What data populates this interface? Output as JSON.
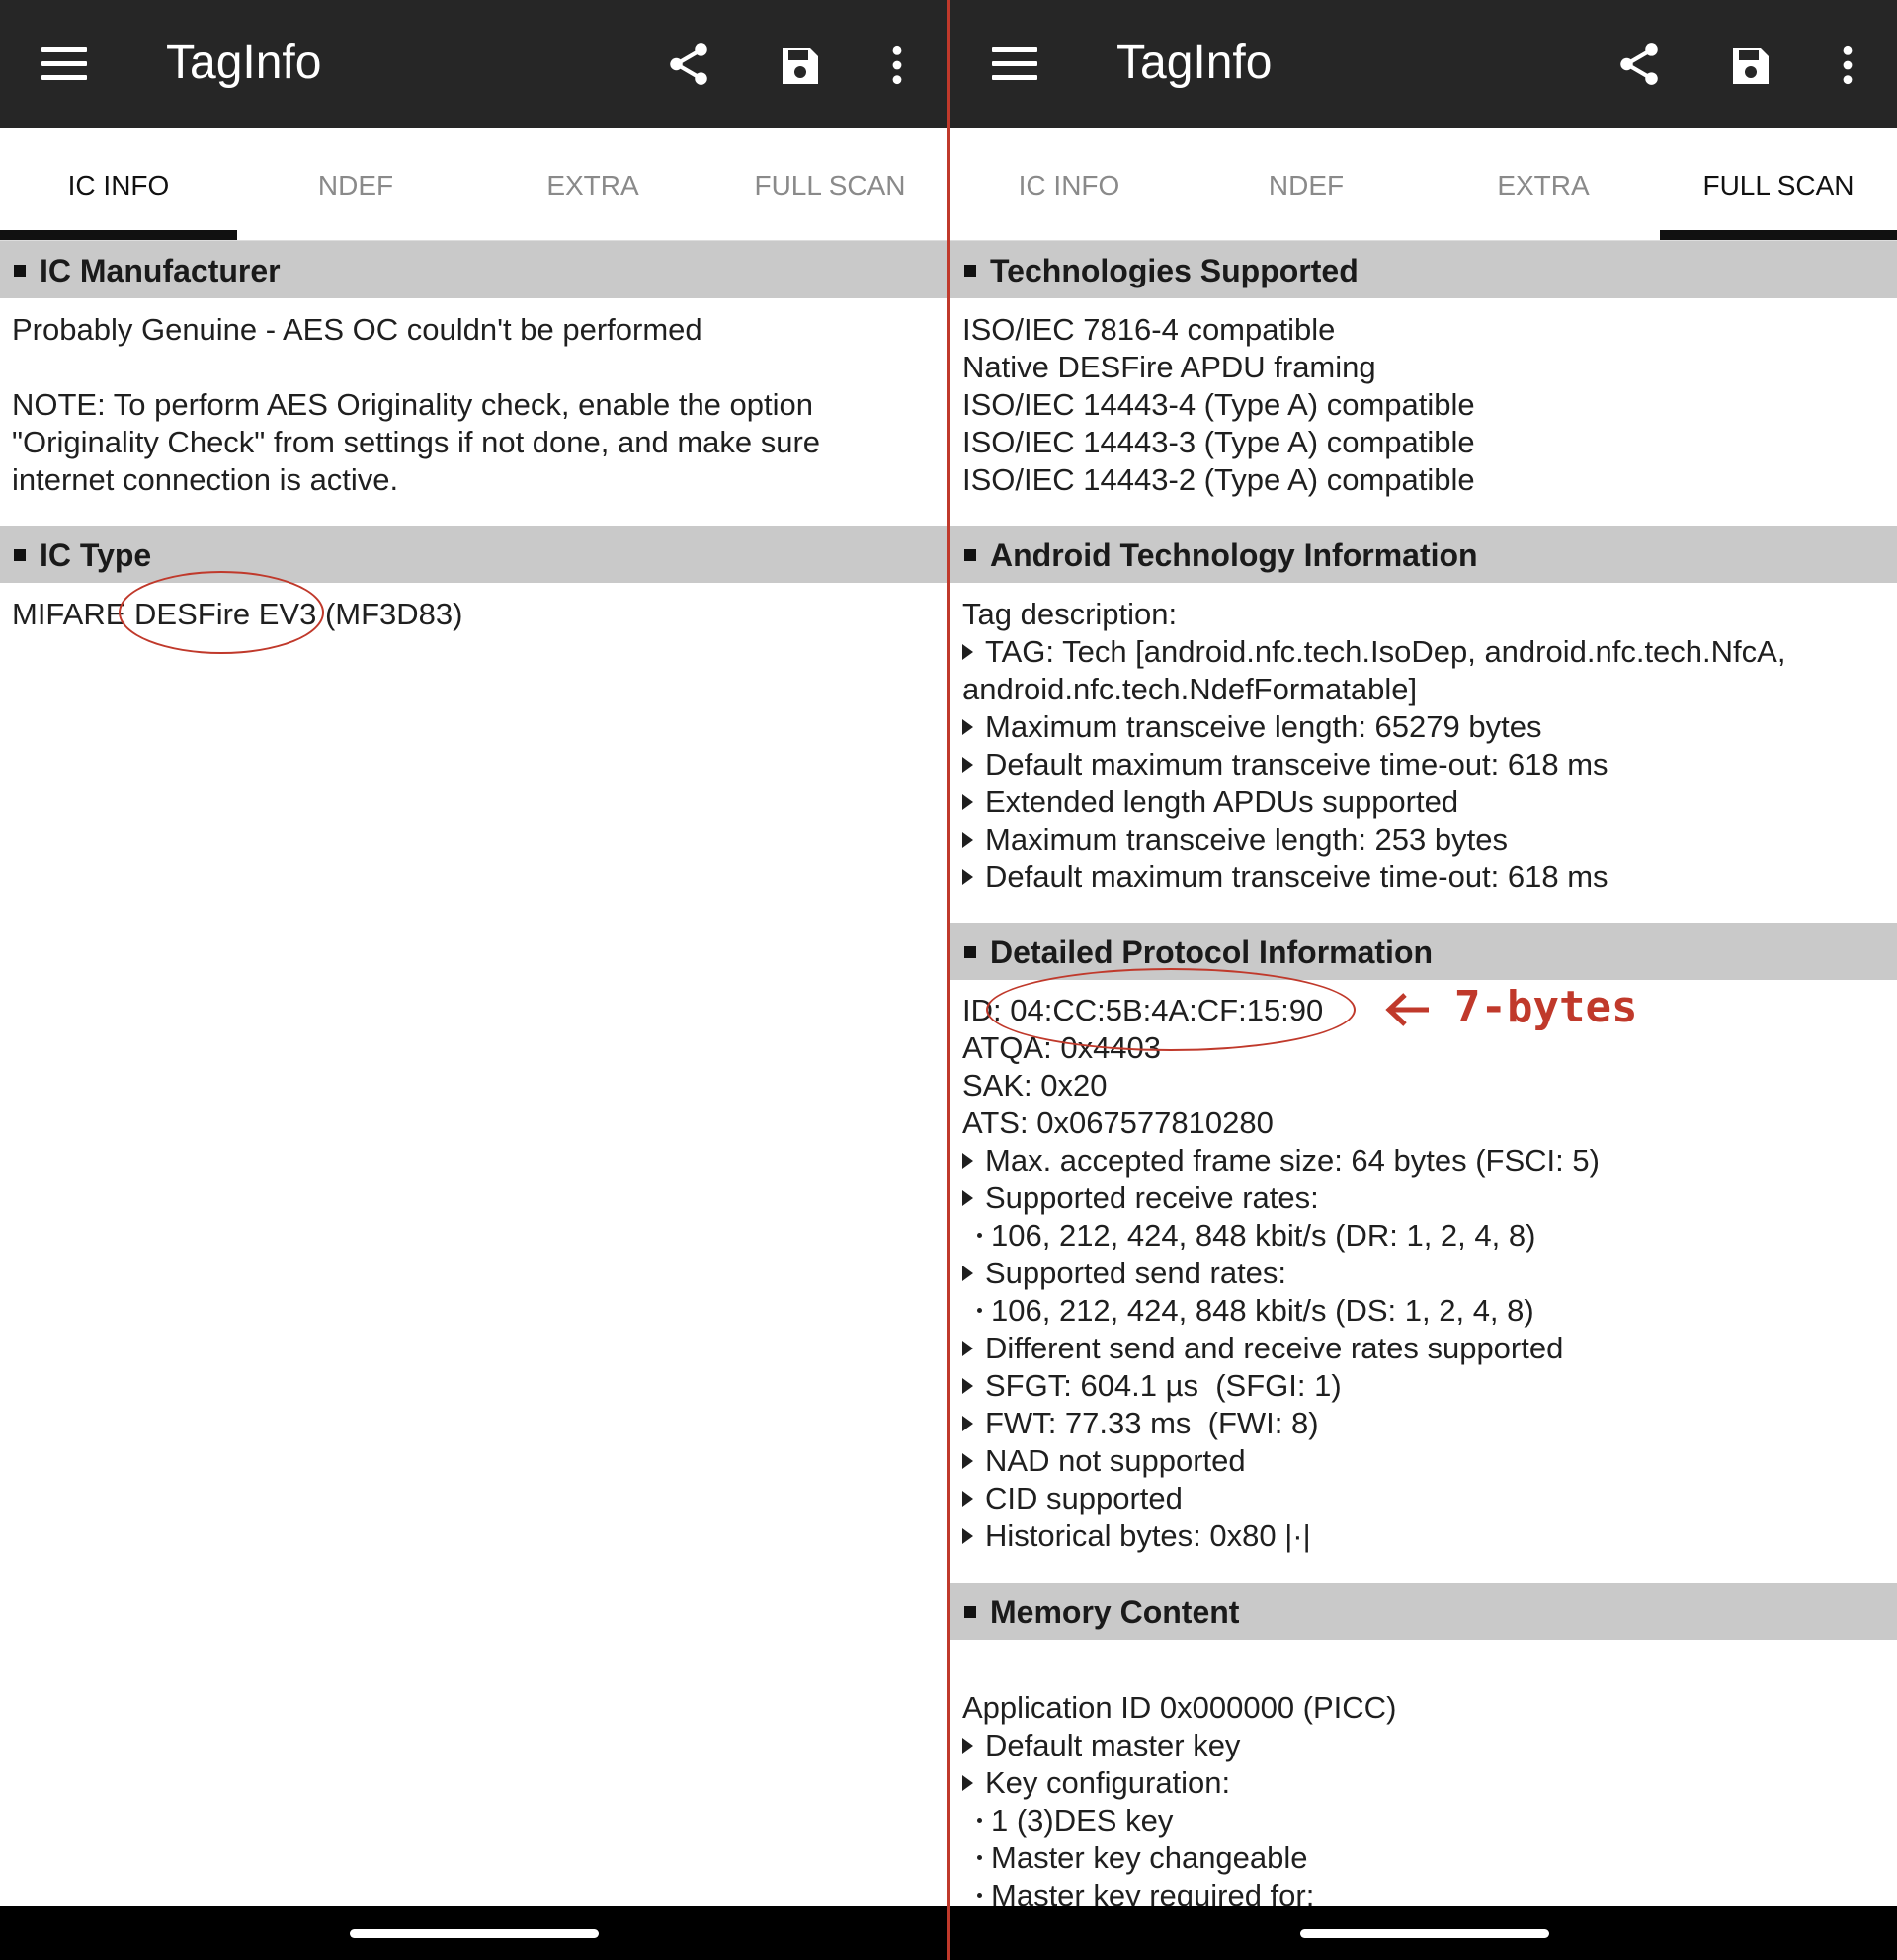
{
  "left": {
    "app_title": "TagInfo",
    "tabs": [
      {
        "label": "IC INFO"
      },
      {
        "label": "NDEF"
      },
      {
        "label": "EXTRA"
      },
      {
        "label": "FULL SCAN"
      }
    ],
    "active_tab": "IC INFO",
    "sections": {
      "ic_manufacturer": {
        "title": "IC Manufacturer",
        "line1": "Probably Genuine - AES OC couldn't be performed",
        "note1": "NOTE: To perform AES Originality check, enable the option",
        "note2": "\"Originality Check\" from settings if not done, and make sure",
        "note3": "internet connection is active."
      },
      "ic_type": {
        "title": "IC Type",
        "value": "MIFARE DESFire EV3 (MF3D83)"
      }
    }
  },
  "right": {
    "app_title": "TagInfo",
    "tabs": [
      {
        "label": "IC INFO"
      },
      {
        "label": "NDEF"
      },
      {
        "label": "EXTRA"
      },
      {
        "label": "FULL SCAN"
      }
    ],
    "active_tab": "FULL SCAN",
    "sections": {
      "technologies": {
        "title": "Technologies Supported",
        "lines": [
          "ISO/IEC 7816-4 compatible",
          "Native DESFire APDU framing",
          "ISO/IEC 14443-4 (Type A) compatible",
          "ISO/IEC 14443-3 (Type A) compatible",
          "ISO/IEC 14443-2 (Type A) compatible"
        ]
      },
      "android": {
        "title": "Android Technology Information",
        "desc": "Tag description:",
        "tag1": "TAG: Tech [android.nfc.tech.IsoDep, android.nfc.tech.NfcA,",
        "tag2": "android.nfc.tech.NdefFormatable]",
        "items": [
          "Maximum transceive length: 65279 bytes",
          "Default maximum transceive time-out: 618 ms",
          "Extended length APDUs supported",
          "Maximum transceive length: 253 bytes",
          "Default maximum transceive time-out: 618 ms"
        ]
      },
      "protocol": {
        "title": "Detailed Protocol Information",
        "id": "ID: 04:CC:5B:4A:CF:15:90",
        "atqa": "ATQA: 0x4403",
        "sak": "SAK: 0x20",
        "ats": "ATS: 0x067577810280",
        "frame_size": "Max. accepted frame size: 64 bytes (FSCI: 5)",
        "receive_rates": "Supported receive rates:",
        "receive_rates_value": "106, 212, 424, 848 kbit/s (DR: 1, 2, 4, 8)",
        "send_rates": "Supported send rates:",
        "send_rates_value": "106, 212, 424, 848 kbit/s (DS: 1, 2, 4, 8)",
        "diff_rates": "Different send and receive rates supported",
        "sfgt": "SFGT: 604.1 µs  (SFGI: 1)",
        "fwt": "FWT: 77.33 ms  (FWI: 8)",
        "nad": "NAD not supported",
        "cid": "CID supported",
        "historical": "Historical bytes: 0x80 |·|"
      },
      "memory": {
        "title": "Memory Content",
        "app_id": "Application ID 0x000000 (PICC)",
        "default_key": "Default master key",
        "key_config": "Key configuration:",
        "key_sub": [
          "1 (3)DES key",
          "Master key changeable",
          "Master key required for:"
        ]
      }
    }
  },
  "annotations": {
    "bytes_label": "7-bytes",
    "color": "#c0392b"
  },
  "colors": {
    "appbar": "#262626",
    "section_header": "#c9c9c9",
    "divider": "#c0392b"
  }
}
